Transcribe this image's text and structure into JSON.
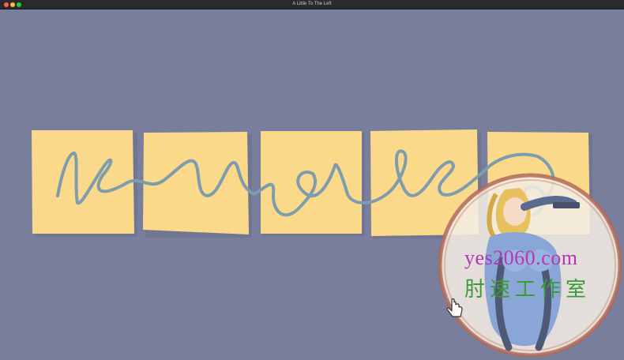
{
  "window": {
    "title": "A Little To The Left"
  },
  "watermark": {
    "line1": "yes2060.com",
    "line2": "肘速工作室"
  },
  "colors": {
    "background": "#787e9b",
    "note": "#fbd98b",
    "scribble": "#7e9dac",
    "shadow": "#6a6f8a"
  },
  "icons": {
    "cursor": "hand-cursor-icon"
  }
}
